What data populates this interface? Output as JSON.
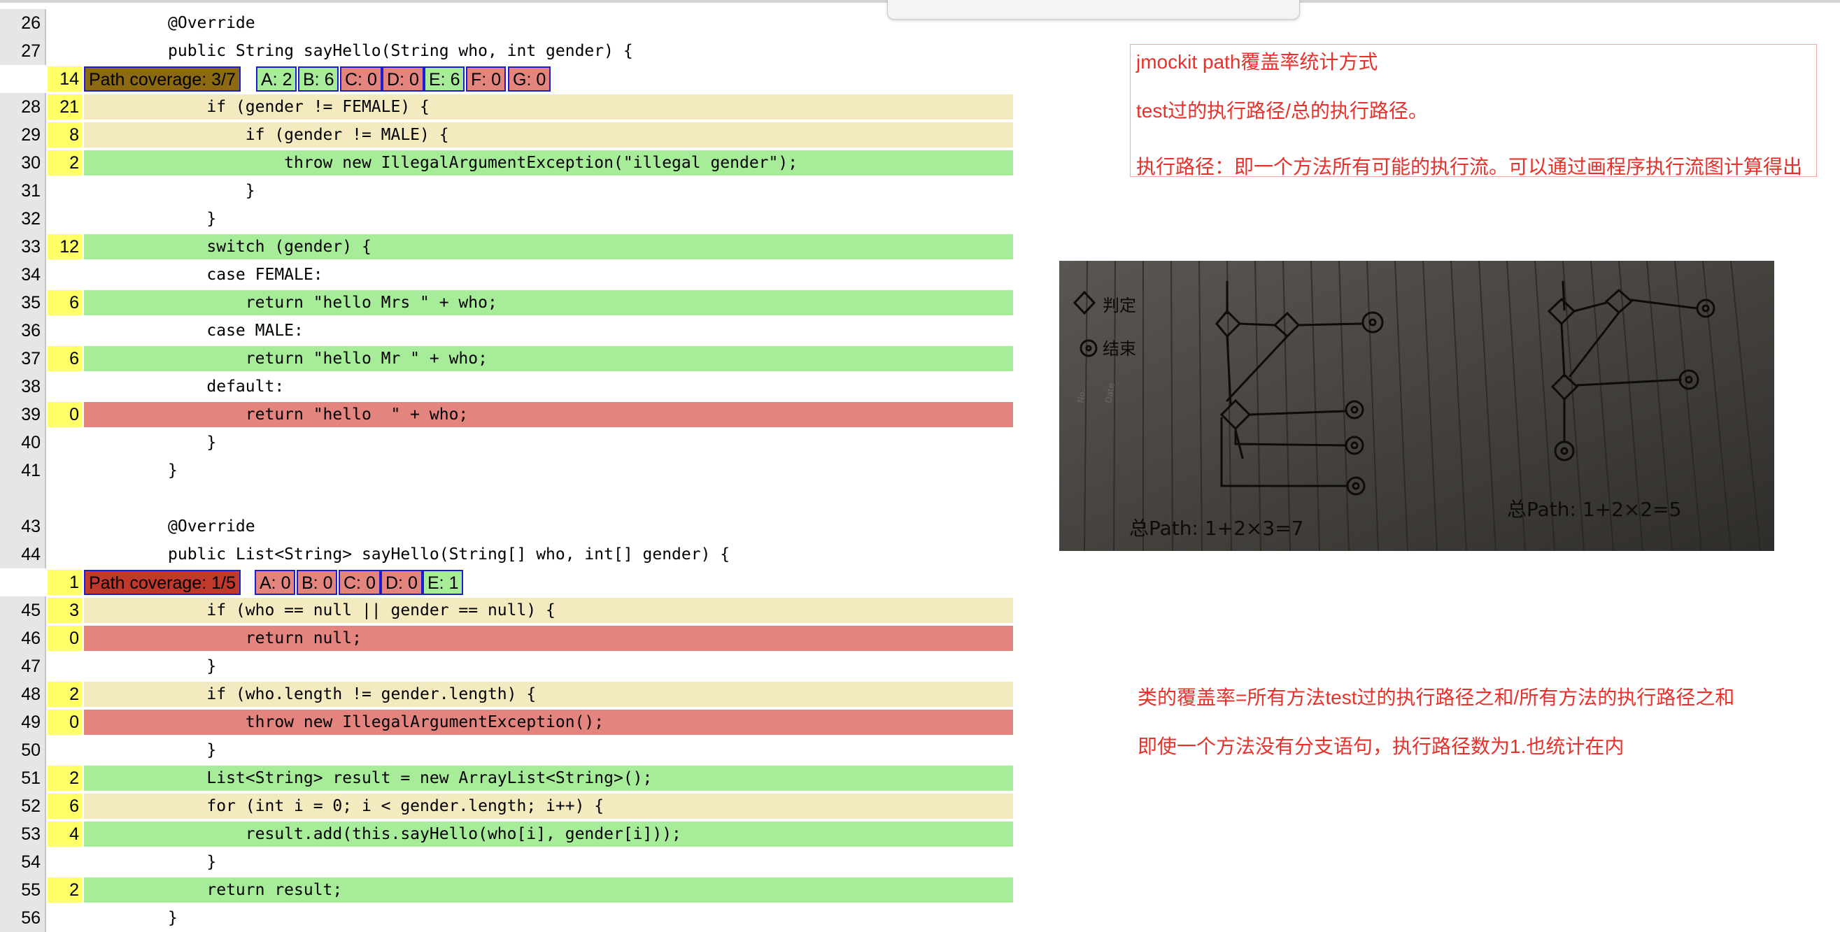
{
  "rows": [
    {
      "ln": "26",
      "cnt": "",
      "hl": "",
      "code": "@Override"
    },
    {
      "ln": "27",
      "cnt": "",
      "hl": "",
      "code": "public String sayHello(String who, int gender) {"
    },
    {
      "type": "path",
      "cnt": "14",
      "summary": "Path coverage: 3/7",
      "paths": [
        "A: 2",
        "B: 6",
        "C: 0",
        "D: 0",
        "E: 6",
        "F: 0",
        "G: 0"
      ]
    },
    {
      "ln": "28",
      "cnt": "21",
      "hl": "y",
      "code": "    if (gender != FEMALE) {"
    },
    {
      "ln": "29",
      "cnt": "8",
      "hl": "y",
      "code": "        if (gender != MALE) {"
    },
    {
      "ln": "30",
      "cnt": "2",
      "hl": "g",
      "code": "            throw new IllegalArgumentException(\"illegal gender\");"
    },
    {
      "ln": "31",
      "cnt": "",
      "hl": "",
      "code": "        }"
    },
    {
      "ln": "32",
      "cnt": "",
      "hl": "",
      "code": "    }"
    },
    {
      "ln": "33",
      "cnt": "12",
      "hl": "g",
      "code": "    switch (gender) {"
    },
    {
      "ln": "34",
      "cnt": "",
      "hl": "",
      "code": "    case FEMALE:"
    },
    {
      "ln": "35",
      "cnt": "6",
      "hl": "g",
      "code": "        return \"hello Mrs \" + who;"
    },
    {
      "ln": "36",
      "cnt": "",
      "hl": "",
      "code": "    case MALE:"
    },
    {
      "ln": "37",
      "cnt": "6",
      "hl": "g",
      "code": "        return \"hello Mr \" + who;"
    },
    {
      "ln": "38",
      "cnt": "",
      "hl": "",
      "code": "    default:"
    },
    {
      "ln": "39",
      "cnt": "0",
      "hl": "r",
      "code": "        return \"hello  \" + who;"
    },
    {
      "ln": "40",
      "cnt": "",
      "hl": "",
      "code": "    }"
    },
    {
      "ln": "41",
      "cnt": "",
      "hl": "",
      "code": "}"
    },
    {
      "ln": "",
      "cnt": "",
      "hl": "",
      "code": ""
    },
    {
      "ln": "43",
      "cnt": "",
      "hl": "",
      "code": "@Override"
    },
    {
      "ln": "44",
      "cnt": "",
      "hl": "",
      "code": "public List<String> sayHello(String[] who, int[] gender) {"
    },
    {
      "type": "path",
      "cnt": "1",
      "summary": "Path coverage: 1/5",
      "paths": [
        "A: 0",
        "B: 0",
        "C: 0",
        "D: 0",
        "E: 1"
      ]
    },
    {
      "ln": "45",
      "cnt": "3",
      "hl": "y",
      "code": "    if (who == null || gender == null) {"
    },
    {
      "ln": "46",
      "cnt": "0",
      "hl": "r",
      "code": "        return null;"
    },
    {
      "ln": "47",
      "cnt": "",
      "hl": "",
      "code": "    }"
    },
    {
      "ln": "48",
      "cnt": "2",
      "hl": "y",
      "code": "    if (who.length != gender.length) {"
    },
    {
      "ln": "49",
      "cnt": "0",
      "hl": "r",
      "code": "        throw new IllegalArgumentException();"
    },
    {
      "ln": "50",
      "cnt": "",
      "hl": "",
      "code": "    }"
    },
    {
      "ln": "51",
      "cnt": "2",
      "hl": "g",
      "code": "    List<String> result = new ArrayList<String>();"
    },
    {
      "ln": "52",
      "cnt": "6",
      "hl": "y",
      "code": "    for (int i = 0; i < gender.length; i++) {"
    },
    {
      "ln": "53",
      "cnt": "4",
      "hl": "g",
      "code": "        result.add(this.sayHello(who[i], gender[i]));"
    },
    {
      "ln": "54",
      "cnt": "",
      "hl": "",
      "code": "    }"
    },
    {
      "ln": "55",
      "cnt": "2",
      "hl": "g",
      "code": "    return result;"
    },
    {
      "ln": "56",
      "cnt": "",
      "hl": "",
      "code": "}"
    }
  ],
  "colors": {
    "covered": "#a7ec98",
    "partial": "#f3eac0",
    "uncovered": "#e3847f",
    "count": "#ffff66",
    "summary_partial": "#8b6a12",
    "summary_low": "#c0392b",
    "note": "#e7312a"
  },
  "notes": {
    "line1": "jmockit path覆盖率统计方式",
    "line2": "test过的执行路径/总的执行路径。",
    "line3": "执行路径：即一个方法所有可能的执行流。可以通过画程序执行流图计算得出",
    "line4": "类的覆盖率=所有方法test过的执行路径之和/所有方法的执行路径之和",
    "line5": "即使一个方法没有分支语句，执行路径数为1.也统计在内"
  },
  "photo": {
    "legend_decision": "判定",
    "legend_end": "结束",
    "paper_no": "No.",
    "paper_date": "Date",
    "formula_left": "总Path: 1+2×3=7",
    "formula_right": "总Path: 1+2×2=5"
  }
}
